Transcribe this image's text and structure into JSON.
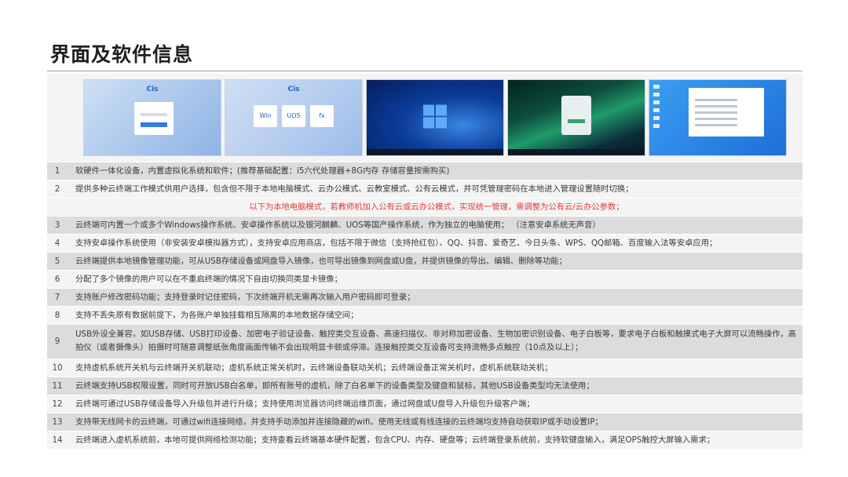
{
  "page": {
    "title": "界面及软件信息"
  },
  "screenshots": {
    "shot1": {
      "brand": "Cis"
    },
    "shot2": {
      "brand": "Cis",
      "tiles": [
        "Win",
        "UOS",
        "fx"
      ]
    }
  },
  "rows": [
    {
      "num": "1",
      "text": "软硬件一体化设备，内置虚拟化系统和软件；(推荐基础配置：i5六代处理器+8G内存 存储容量按需购买)"
    },
    {
      "num": "2",
      "text": "提供多种云终端工作模式供用户选择，包含但不限于本地电脑模式、云办公模式、云教室模式、公有云模式，并可凭管理密码在本地进入管理设置随时切换；"
    },
    {
      "num": "",
      "text": "以下为本地电脑模式，若教师机加入公有云或云办公模式，实现统一管理，需调整为公有云/云办公参数；"
    },
    {
      "num": "3",
      "text": "云终端可内置一个或多个Windows操作系统、安卓操作系统以及银河麒麟、UOS等国产操作系统，作为独立的电脑使用；  （注意安卓系统无声音）"
    },
    {
      "num": "4",
      "text": "支持安卓操作系统使用（非安装安卓模拟器方式），支持安卓应用商店，包括不限于微信（支持抢红包）、QQ、抖音、爱奇艺、今日头条、WPS、QQ邮箱、百度输入法等安卓应用；"
    },
    {
      "num": "5",
      "text": "云终端提供本地镜像管理功能，可从USB存储设备或网盘导入镜像，也可导出镜像到网盘或U盘，并提供镜像的导出、编辑、删除等功能；"
    },
    {
      "num": "6",
      "text": "分配了多个镜像的用户可以在不重启终端的情况下自由切换同类显卡镜像；"
    },
    {
      "num": "7",
      "text": "支持账户修改密码功能；支持登录时记住密码，下次终端开机无需再次输入用户密码即可登录；"
    },
    {
      "num": "8",
      "text": "支持不丢失原有数据前提下，为各账户单独挂载相互隔离的本地数据存储空间；"
    },
    {
      "num": "9",
      "text": "USB外设全兼容，如USB存储、USB打印设备、加密电子验证设备、触控类交互设备、高速扫描仪、非对称加密设备、生物加密识别设备、电子白板等，要求电子白板和触摸式电子大屏可以流畅操作，高拍仪（或者摄像头）拍摄时可随意调整纸张角度画面传输不会出现明显卡顿或停滞。连接触控类交互设备可支持流畅多点触控（10点及以上）；"
    },
    {
      "num": "10",
      "text": "支持虚机系统开关机与云终端开关机联动；虚机系统正常关机时，云终端设备联动关机；云终端设备正常关机时，虚机系统联动关机；"
    },
    {
      "num": "11",
      "text": "云终端支持USB权限设置，同时可开放USB白名单，即所有账号的虚机，除了白名单下的设备类型及键盘和鼠标，其他USB设备类型均无法使用；"
    },
    {
      "num": "12",
      "text": "云终端可通过USB存储设备导入升级包并进行升级；支持使用浏览器访问终端运维页面，通过网盘或U盘导入升级包升级客户端；"
    },
    {
      "num": "13",
      "text": "支持带无线网卡的云终端，可通过wifi连接网络，并支持手动添加并连接隐藏的wifi。使用无线或有线连接的云终端均支持自动获取IP或手动设置IP；"
    },
    {
      "num": "14",
      "text": "云终端进入虚机系统前，本地可提供网络检测功能；支持查看云终端基本硬件配置，包含CPU、内存、硬盘等；云终端登录系统前，支持软键盘输入，满足OPS触控大屏输入需求；"
    }
  ]
}
